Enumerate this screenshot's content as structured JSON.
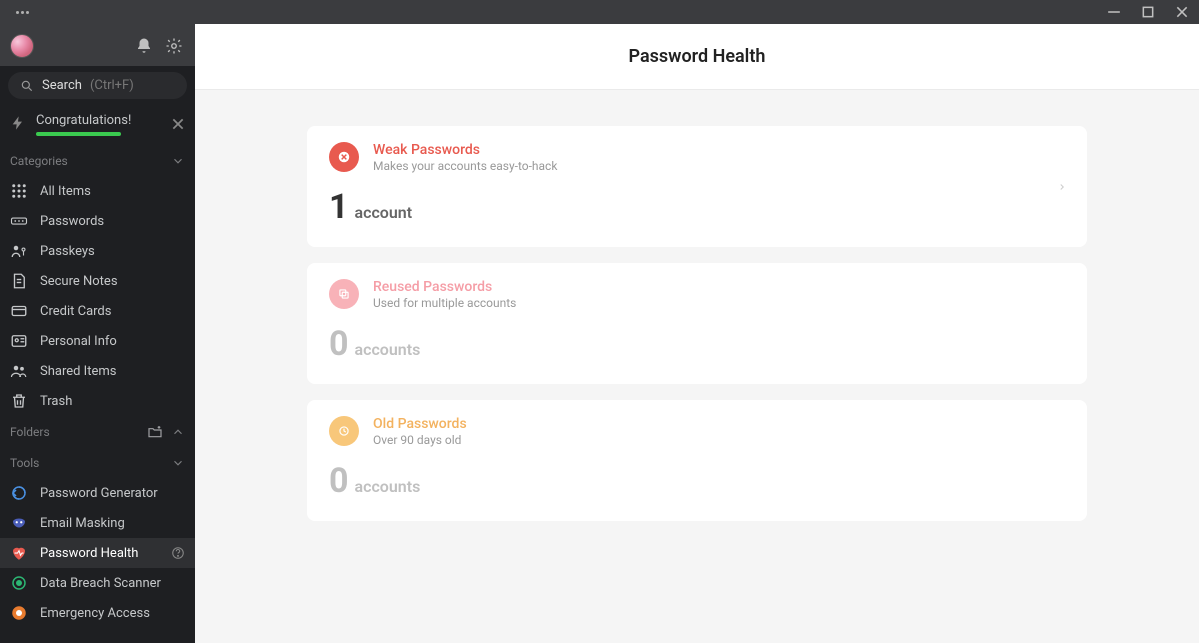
{
  "search": {
    "label": "Search",
    "hint": "(Ctrl+F)"
  },
  "banner": {
    "title": "Congratulations!"
  },
  "sections": {
    "categories": "Categories",
    "folders": "Folders",
    "tools": "Tools"
  },
  "categories": [
    {
      "label": "All Items"
    },
    {
      "label": "Passwords"
    },
    {
      "label": "Passkeys"
    },
    {
      "label": "Secure Notes"
    },
    {
      "label": "Credit Cards"
    },
    {
      "label": "Personal Info"
    },
    {
      "label": "Shared Items"
    },
    {
      "label": "Trash"
    }
  ],
  "tools": [
    {
      "label": "Password Generator"
    },
    {
      "label": "Email Masking"
    },
    {
      "label": "Password Health"
    },
    {
      "label": "Data Breach Scanner"
    },
    {
      "label": "Emergency Access"
    }
  ],
  "page": {
    "title": "Password Health"
  },
  "cards": {
    "weak": {
      "title": "Weak Passwords",
      "sub": "Makes your accounts easy-to-hack",
      "count": "1",
      "unit": "account"
    },
    "reused": {
      "title": "Reused Passwords",
      "sub": "Used for multiple accounts",
      "count": "0",
      "unit": "accounts"
    },
    "old": {
      "title": "Old Passwords",
      "sub": "Over 90 days old",
      "count": "0",
      "unit": "accounts"
    }
  }
}
